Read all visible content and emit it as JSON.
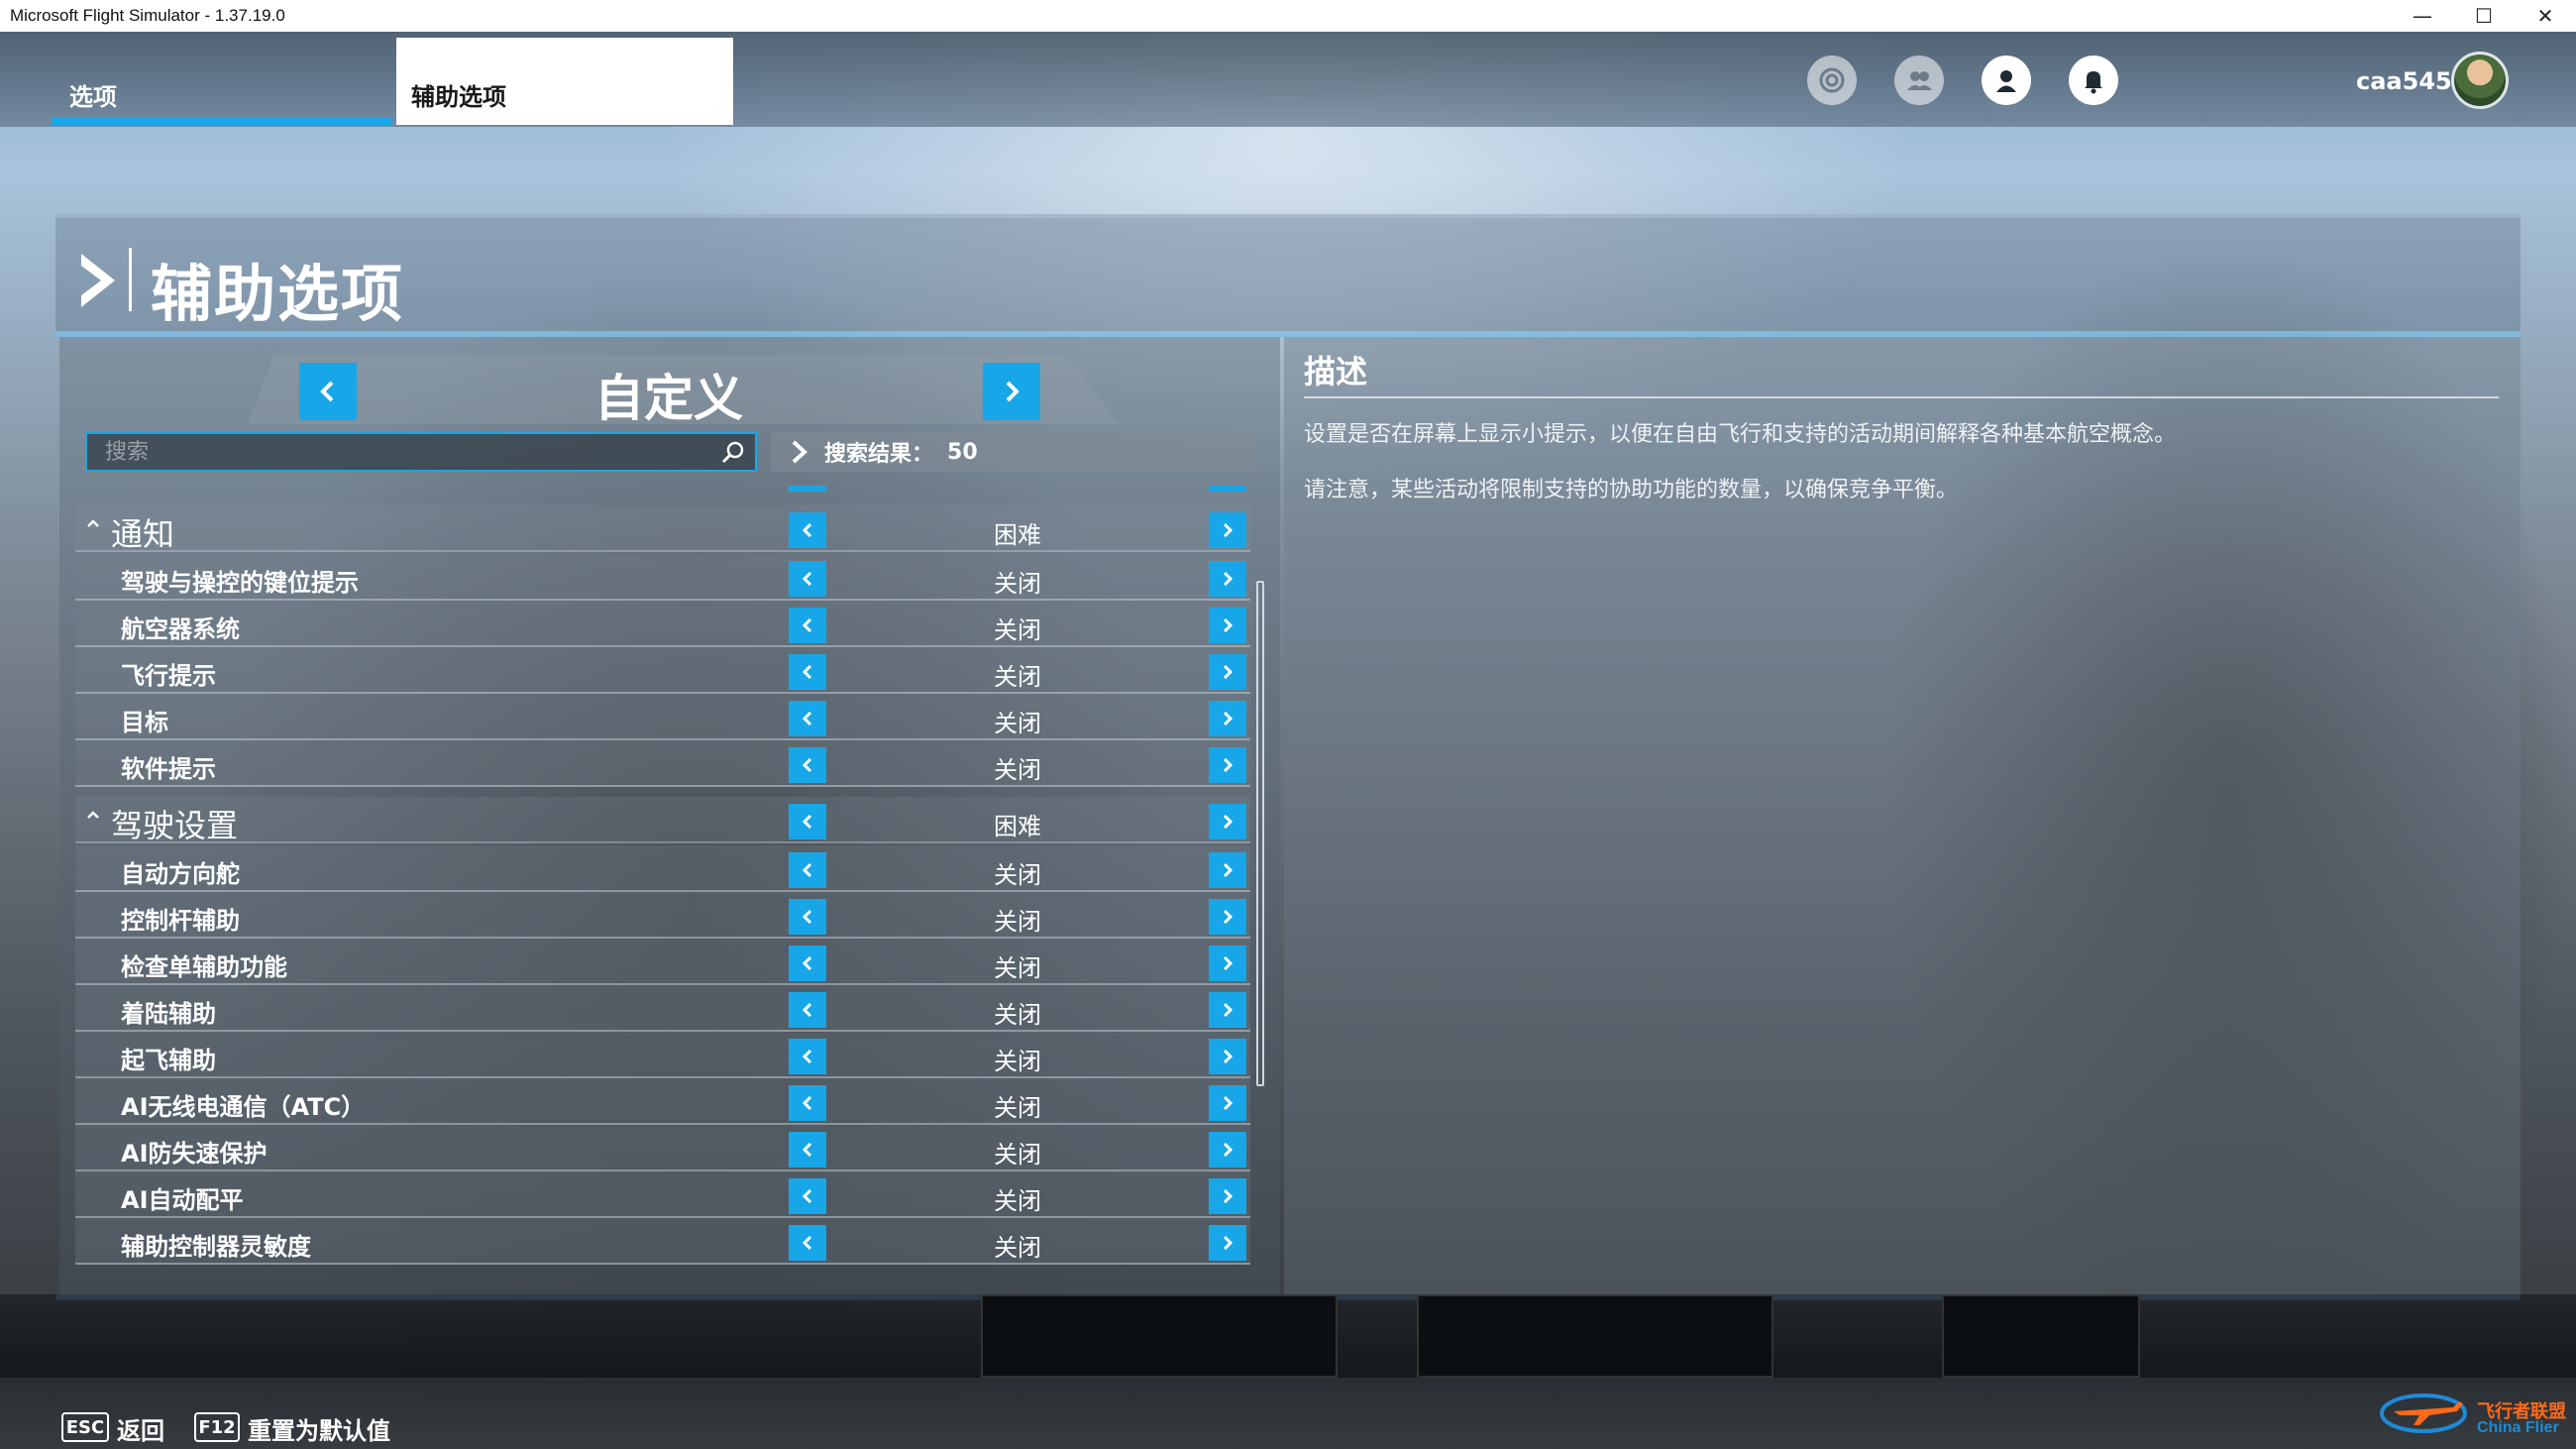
{
  "window": {
    "title": "Microsoft Flight Simulator - 1.37.19.0",
    "minimize_glyph": "—",
    "maximize_glyph": "☐",
    "close_glyph": "✕"
  },
  "topnav": {
    "tabs": [
      {
        "label": "选项",
        "active": false
      },
      {
        "label": "辅助选项",
        "active": true
      }
    ],
    "icons": [
      "activity-icon",
      "friends-icon",
      "profile-icon",
      "notifications-icon"
    ],
    "username": "caa545"
  },
  "page": {
    "title": "辅助选项",
    "preset": "自定义",
    "search": {
      "placeholder": "搜索",
      "value": ""
    },
    "results": {
      "label": "搜索结果：",
      "count": "50"
    }
  },
  "sections": [
    {
      "title": "通知",
      "value": "困难",
      "items": [
        {
          "label": "驾驶与操控的键位提示",
          "value": "关闭"
        },
        {
          "label": "航空器系统",
          "value": "关闭"
        },
        {
          "label": "飞行提示",
          "value": "关闭"
        },
        {
          "label": "目标",
          "value": "关闭"
        },
        {
          "label": "软件提示",
          "value": "关闭"
        }
      ]
    },
    {
      "title": "驾驶设置",
      "value": "困难",
      "items": [
        {
          "label": "自动方向舵",
          "value": "关闭"
        },
        {
          "label": "控制杆辅助",
          "value": "关闭"
        },
        {
          "label": "检查单辅助功能",
          "value": "关闭"
        },
        {
          "label": "着陆辅助",
          "value": "关闭"
        },
        {
          "label": "起飞辅助",
          "value": "关闭"
        },
        {
          "label": "AI无线电通信（ATC）",
          "value": "关闭"
        },
        {
          "label": "AI防失速保护",
          "value": "关闭"
        },
        {
          "label": "AI自动配平",
          "value": "关闭"
        },
        {
          "label": "辅助控制器灵敏度",
          "value": "关闭"
        }
      ]
    }
  ],
  "description": {
    "title": "描述",
    "lines": [
      "设置是否在屏幕上显示小提示，以便在自由飞行和支持的活动期间解释各种基本航空概念。",
      "请注意，某些活动将限制支持的协助功能的数量，以确保竞争平衡。"
    ]
  },
  "bottom": {
    "keys": [
      {
        "key": "ESC",
        "label": "返回"
      },
      {
        "key": "F12",
        "label": "重置为默认值"
      }
    ],
    "watermark": {
      "cn": "飞行者联盟",
      "en": "China Flier"
    }
  },
  "colors": {
    "accent": "#17a7e8",
    "watermark_orange": "#ff6a1a",
    "watermark_blue": "#1e8ad8"
  }
}
